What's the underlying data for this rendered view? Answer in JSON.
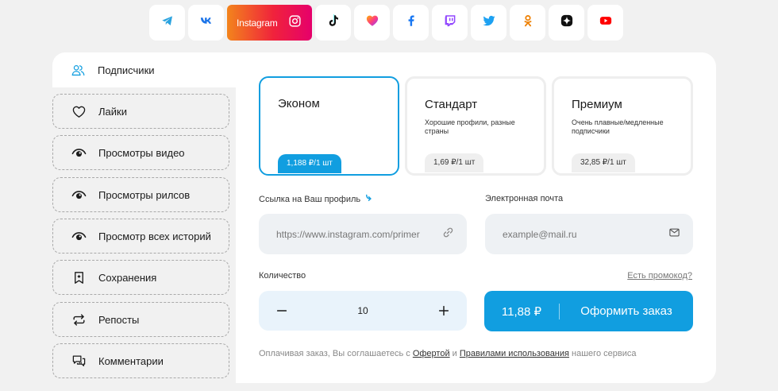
{
  "networks": [
    {
      "name": "telegram",
      "icon": "telegram-icon"
    },
    {
      "name": "vk",
      "icon": "vk-icon"
    },
    {
      "name": "instagram",
      "icon": "instagram-icon",
      "label": "Instagram",
      "active": true
    },
    {
      "name": "tiktok",
      "icon": "tiktok-icon"
    },
    {
      "name": "likee",
      "icon": "likee-heart-icon"
    },
    {
      "name": "facebook",
      "icon": "facebook-icon"
    },
    {
      "name": "twitch",
      "icon": "twitch-icon"
    },
    {
      "name": "twitter",
      "icon": "twitter-icon"
    },
    {
      "name": "odnoklassniki",
      "icon": "odnoklassniki-icon"
    },
    {
      "name": "dzen",
      "icon": "dzen-icon"
    },
    {
      "name": "youtube",
      "icon": "youtube-icon"
    }
  ],
  "services": [
    {
      "label": "Подписчики",
      "icon": "followers-icon",
      "active": true
    },
    {
      "label": "Лайки",
      "icon": "heart-icon"
    },
    {
      "label": "Просмотры видео",
      "icon": "eye-icon"
    },
    {
      "label": "Просмотры рилсов",
      "icon": "eye-icon"
    },
    {
      "label": "Просмотр всех историй",
      "icon": "eye-icon"
    },
    {
      "label": "Сохранения",
      "icon": "bookmark-icon"
    },
    {
      "label": "Репосты",
      "icon": "repost-icon"
    },
    {
      "label": "Комментарии",
      "icon": "comments-icon"
    }
  ],
  "tariffs": [
    {
      "name": "Эконом",
      "desc": "",
      "price": "1,188 ₽/1 шт",
      "selected": true
    },
    {
      "name": "Стандарт",
      "desc": "Хорошие профили, разные страны",
      "price": "1,69 ₽/1 шт"
    },
    {
      "name": "Премиум",
      "desc": "Очень плавные/медленные подписчики",
      "price": "32,85 ₽/1 шт"
    }
  ],
  "form": {
    "link_label": "Ссылка на Ваш профиль",
    "link_placeholder": "https://www.instagram.com/primer",
    "email_label": "Электронная почта",
    "email_placeholder": "example@mail.ru",
    "qty_label": "Количество",
    "qty_value": "10",
    "promo": "Есть промокод?"
  },
  "order": {
    "sum": "11,88 ₽",
    "action": "Оформить заказ"
  },
  "terms": {
    "prefix": "Оплачивая заказ, Вы соглашаетесь с ",
    "offer": "Офертой",
    "and": " и ",
    "rules": "Правилами использования",
    "suffix": " нашего сервиса"
  },
  "colors": {
    "accent": "#119ee0",
    "instagram_gradient": [
      "#f3841c",
      "#f0223c",
      "#e6006b"
    ]
  }
}
